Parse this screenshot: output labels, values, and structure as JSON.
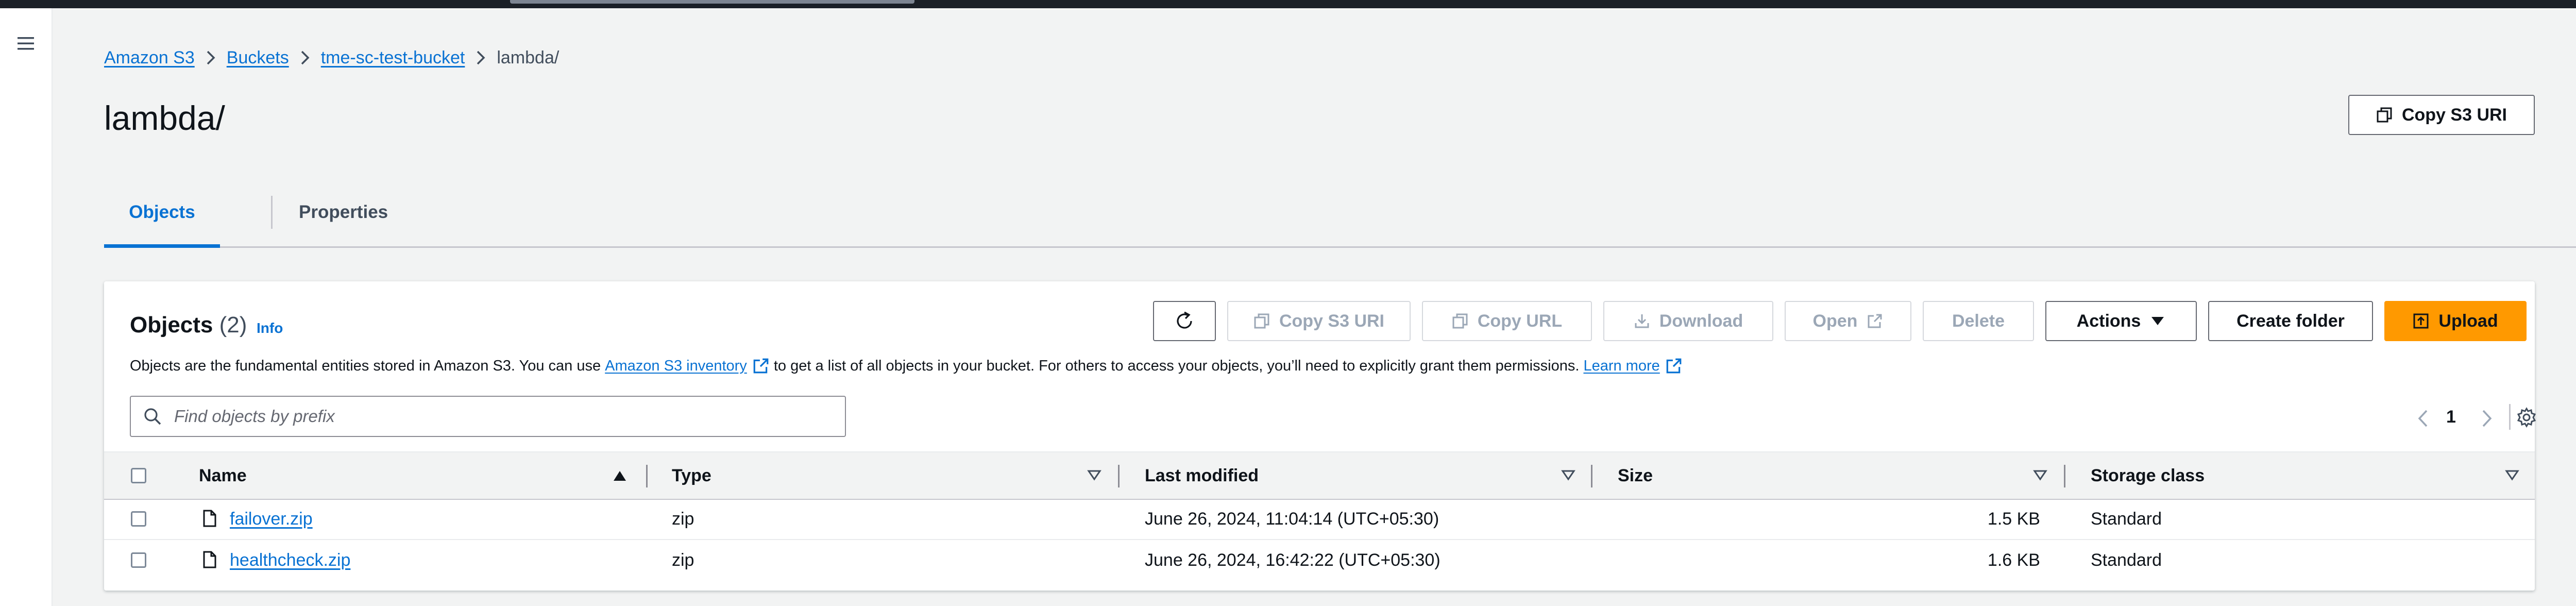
{
  "breadcrumb": {
    "items": [
      "Amazon S3",
      "Buckets",
      "tme-sc-test-bucket"
    ],
    "current": "lambda/"
  },
  "page": {
    "title": "lambda/",
    "copy_uri_label": "Copy S3 URI"
  },
  "tabs": [
    {
      "label": "Objects",
      "active": true
    },
    {
      "label": "Properties",
      "active": false
    }
  ],
  "objects_panel": {
    "title": "Objects",
    "count": "(2)",
    "info_label": "Info",
    "description_before": "Objects are the fundamental entities stored in Amazon S3. You can use",
    "inventory_link": "Amazon S3 inventory",
    "description_after": "to get a list of all objects in your bucket. For others to access your objects, you’ll need to explicitly grant them permissions.",
    "learn_more": "Learn more",
    "toolbar": {
      "copy_uri": "Copy S3 URI",
      "copy_url": "Copy URL",
      "download": "Download",
      "open": "Open",
      "delete": "Delete",
      "actions": "Actions",
      "create_folder": "Create folder",
      "upload": "Upload"
    },
    "search_placeholder": "Find objects by prefix",
    "pagination": {
      "current_page": "1"
    },
    "columns": [
      "Name",
      "Type",
      "Last modified",
      "Size",
      "Storage class"
    ],
    "rows": [
      {
        "name": "failover.zip",
        "type": "zip",
        "last_modified": "June 26, 2024, 11:04:14 (UTC+05:30)",
        "size": "1.5 KB",
        "storage_class": "Standard"
      },
      {
        "name": "healthcheck.zip",
        "type": "zip",
        "last_modified": "June 26, 2024, 16:42:22 (UTC+05:30)",
        "size": "1.6 KB",
        "storage_class": "Standard"
      }
    ]
  },
  "colors": {
    "link": "#0972d3",
    "primary_button": "#ff9900",
    "page_background": "#f2f3f3",
    "top_bar": "#1b2027"
  },
  "icons": {
    "leftnav": "hamburger-menu-icon",
    "rightbar": [
      "info-circle-icon",
      "hexagon-settings-icon"
    ],
    "row": "file-icon",
    "external": "external-link-icon"
  }
}
